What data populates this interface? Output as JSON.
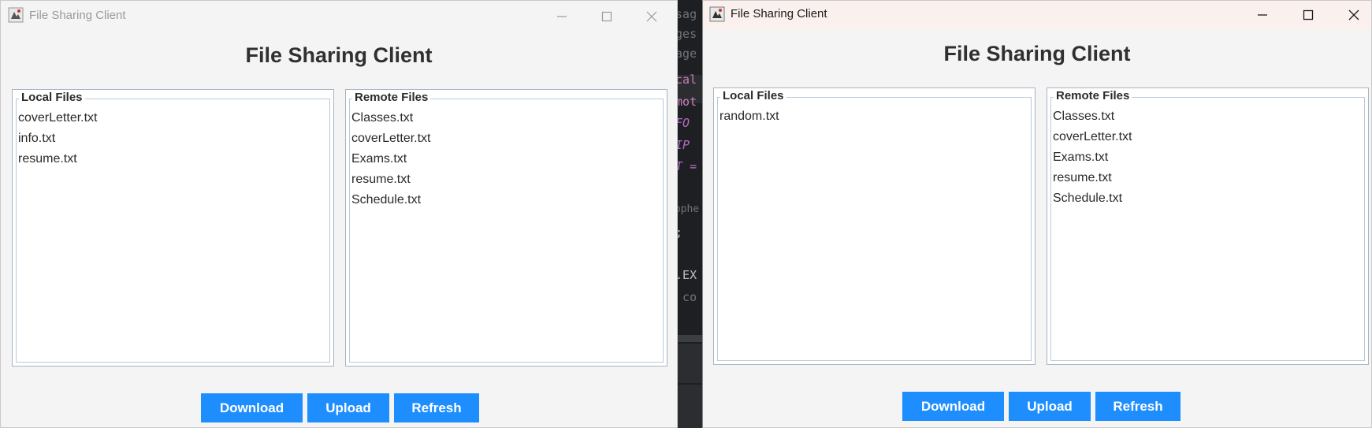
{
  "background_ide": {
    "lines": [
      "usag",
      "ages",
      "sage",
      "ocal",
      "emot",
      "_FO",
      "_IP",
      "RT =",
      "tophe",
      ");",
      ":",
      "e.EX",
      "/ co"
    ]
  },
  "windows": [
    {
      "title": "File Sharing Client",
      "heading": "File Sharing Client",
      "local_files": {
        "label": "Local Files",
        "items": [
          "coverLetter.txt",
          "info.txt",
          "resume.txt"
        ]
      },
      "remote_files": {
        "label": "Remote Files",
        "items": [
          "Classes.txt",
          "coverLetter.txt",
          "Exams.txt",
          "resume.txt",
          "Schedule.txt"
        ]
      },
      "buttons": {
        "download": "Download",
        "upload": "Upload",
        "refresh": "Refresh"
      },
      "focused": false
    },
    {
      "title": "File Sharing Client",
      "heading": "File Sharing Client",
      "local_files": {
        "label": "Local Files",
        "items": [
          "random.txt"
        ]
      },
      "remote_files": {
        "label": "Remote Files",
        "items": [
          "Classes.txt",
          "coverLetter.txt",
          "Exams.txt",
          "resume.txt",
          "Schedule.txt"
        ]
      },
      "buttons": {
        "download": "Download",
        "upload": "Upload",
        "refresh": "Refresh"
      },
      "focused": true
    }
  ],
  "icons": {
    "app": "java-app-icon",
    "minimize": "minimize-icon",
    "maximize": "maximize-icon",
    "close": "close-icon"
  },
  "colors": {
    "button": "#1e8eff",
    "window_bg": "#f4f4f4",
    "focused_titlebar": "#faf1ee"
  }
}
